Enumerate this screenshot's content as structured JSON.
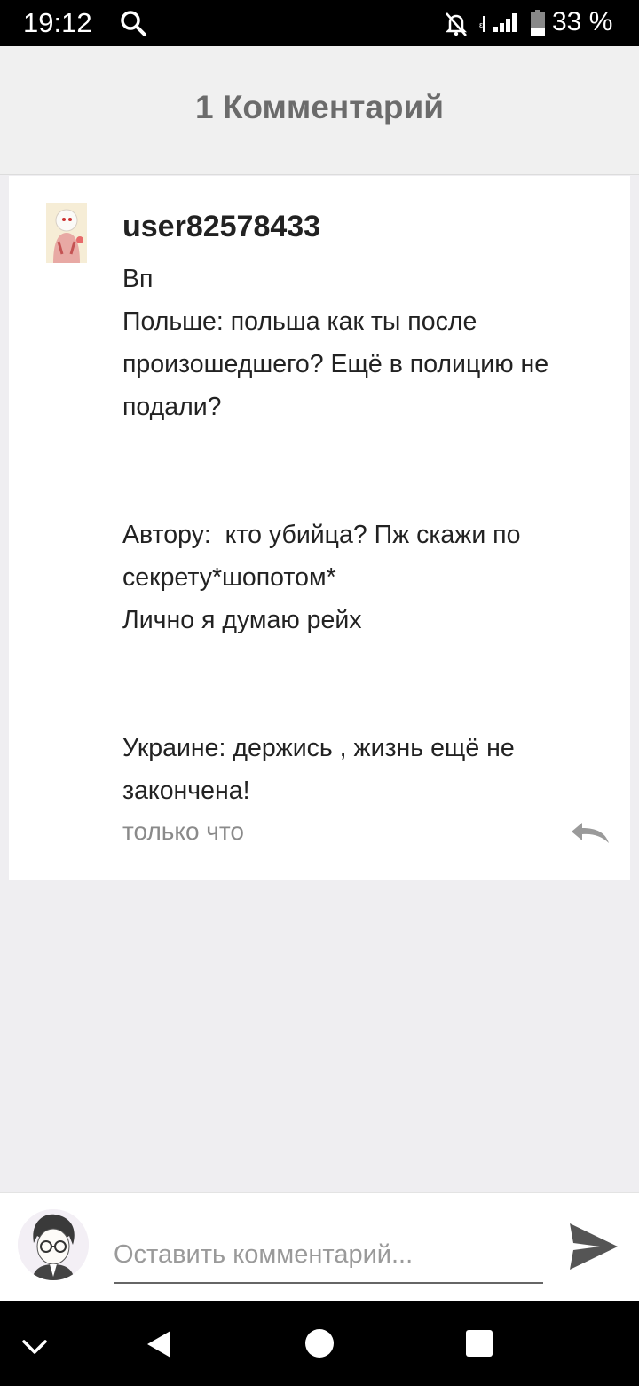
{
  "status_bar": {
    "time": "19:12",
    "battery": "33 %",
    "icons": [
      "search-icon",
      "notifications-muted-icon",
      "signal-icon",
      "battery-icon"
    ]
  },
  "header": {
    "title": "1 Комментарий"
  },
  "comment": {
    "username": "user82578433",
    "text": "Вп\nПольше: польша как ты после произошедшего? Ещё в полицию не подали?\n\n\nАвтору:  кто убийца? Пж скажи по секрету*шопотом*\nЛично я думаю рейх\n\n\nУкраине: держись , жизнь ещё не закончена!",
    "time": "только что"
  },
  "composer": {
    "placeholder": "Оставить комментарий..."
  },
  "nav": {
    "icons": [
      "collapse-icon",
      "back-icon",
      "home-icon",
      "recents-icon"
    ]
  },
  "colors": {
    "background": "#efeef1",
    "header_bg": "#f0f0f0",
    "card_bg": "#ffffff",
    "muted_text": "#8a8a8a"
  }
}
